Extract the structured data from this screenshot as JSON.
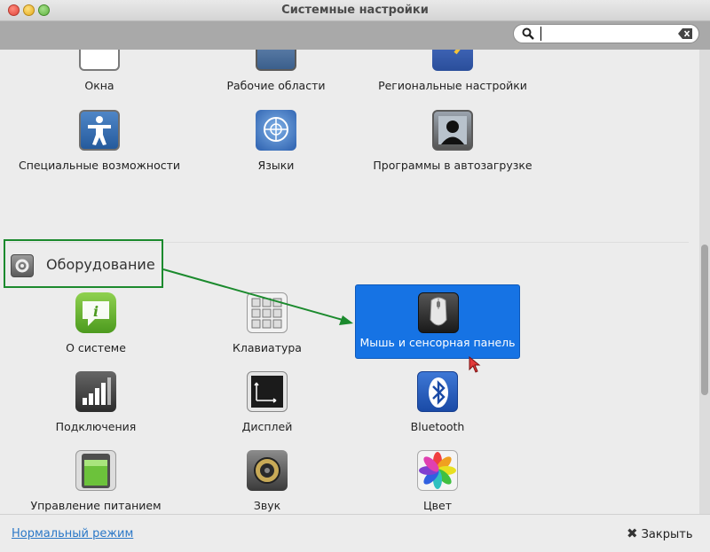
{
  "window": {
    "title": "Системные настройки"
  },
  "search": {
    "value": "",
    "placeholder": ""
  },
  "top_rows": [
    {
      "label": "Окна",
      "icon": "windows-icon"
    },
    {
      "label": "Рабочие области",
      "icon": "workspaces-icon"
    },
    {
      "label": "Региональные настройки",
      "icon": "regional-icon"
    },
    {
      "label": "Специальные возможности",
      "icon": "accessibility-icon"
    },
    {
      "label": "Языки",
      "icon": "languages-icon"
    },
    {
      "label": "Программы в автозагрузке",
      "icon": "startup-programs-icon"
    }
  ],
  "hardware": {
    "title": "Оборудование",
    "items": [
      {
        "label": "О системе",
        "icon": "info-icon"
      },
      {
        "label": "Клавиатура",
        "icon": "keyboard-icon"
      },
      {
        "label": "Мышь и сенсорная панель",
        "icon": "mouse-icon"
      },
      {
        "label": "Подключения",
        "icon": "network-signal-icon"
      },
      {
        "label": "Дисплей",
        "icon": "display-icon"
      },
      {
        "label": "Bluetooth",
        "icon": "bluetooth-icon"
      },
      {
        "label": "Управление питанием",
        "icon": "battery-icon"
      },
      {
        "label": "Звук",
        "icon": "speaker-icon"
      },
      {
        "label": "Цвет",
        "icon": "color-icon"
      }
    ]
  },
  "footer": {
    "mode_link": "Нормальный режим",
    "close_label": "Закрыть"
  },
  "colors": {
    "selection": "#1673e4",
    "annotation": "#1b8a2d",
    "link": "#2b78c7"
  }
}
